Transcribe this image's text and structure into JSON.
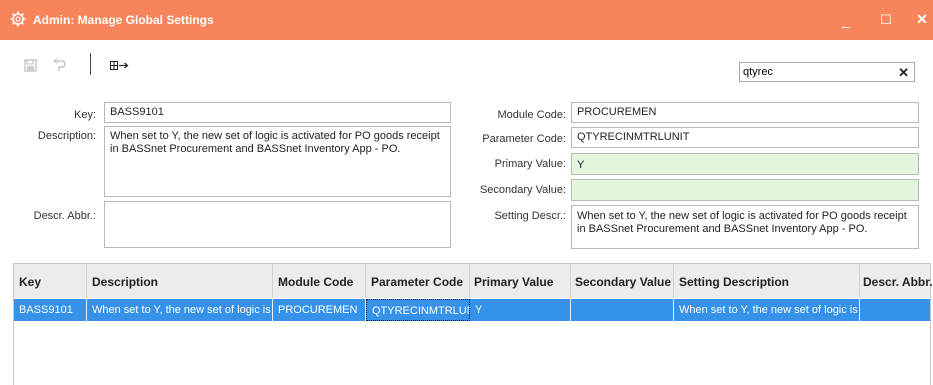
{
  "window": {
    "title": "Admin: Manage Global Settings",
    "controls": {
      "minimize": "_",
      "maximize": "☐",
      "close": "✕"
    },
    "accent": "#f7845a"
  },
  "toolbar": {
    "save_icon": "save-icon",
    "undo_icon": "undo-icon",
    "export_icon": "export-grid-icon",
    "search": {
      "value": "qtyrec",
      "clear": "✕"
    }
  },
  "form": {
    "key_label": "Key:",
    "key_value": "BASS9101",
    "description_label": "Description:",
    "description_value": "When set to Y, the new set of logic is activated for PO goods receipt in BASSnet Procurement and BASSnet Inventory App - PO.",
    "descr_abbr_label": "Descr. Abbr.:",
    "descr_abbr_value": "",
    "module_code_label": "Module Code:",
    "module_code_value": "PROCUREMEN",
    "parameter_code_label": "Parameter Code:",
    "parameter_code_value": "QTYRECINMTRLUNIT",
    "primary_value_label": "Primary Value:",
    "primary_value_value": "Y",
    "secondary_value_label": "Secondary Value:",
    "secondary_value_value": "",
    "setting_descr_label": "Setting Descr.:",
    "setting_descr_value": "When set to Y, the new set of logic is activated for PO goods receipt in BASSnet Procurement and BASSnet Inventory App - PO."
  },
  "grid": {
    "headers": [
      "Key",
      "Description",
      "Module Code",
      "Parameter Code",
      "Primary Value",
      "Secondary Value",
      "Setting Description",
      "Descr. Abbr."
    ],
    "rows": [
      [
        "BASS9101",
        "When set to Y, the new set of logic is ac",
        "PROCUREMEN",
        "QTYRECINMTRLUNIT",
        "Y",
        "",
        "When set to Y, the new set of logic is ac",
        ""
      ]
    ],
    "selection_color": "#3592e8"
  }
}
